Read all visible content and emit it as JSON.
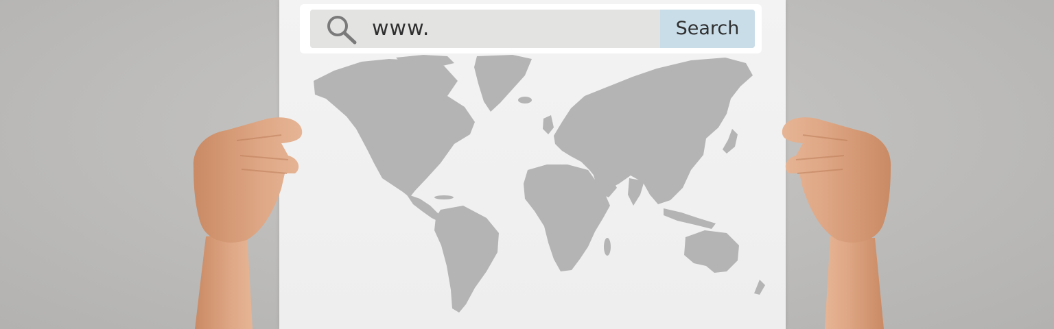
{
  "search": {
    "url_value": "www.",
    "button_label": "Search",
    "icon": "search-icon"
  },
  "scene": {
    "poster_content": "world-map",
    "colors": {
      "background": "#bdbcba",
      "poster": "#f1f1f1",
      "search_bar": "#e3e3e2",
      "search_button": "#c9dde9",
      "map_land": "#b4b4b4",
      "skin": "#d9a27f"
    }
  }
}
